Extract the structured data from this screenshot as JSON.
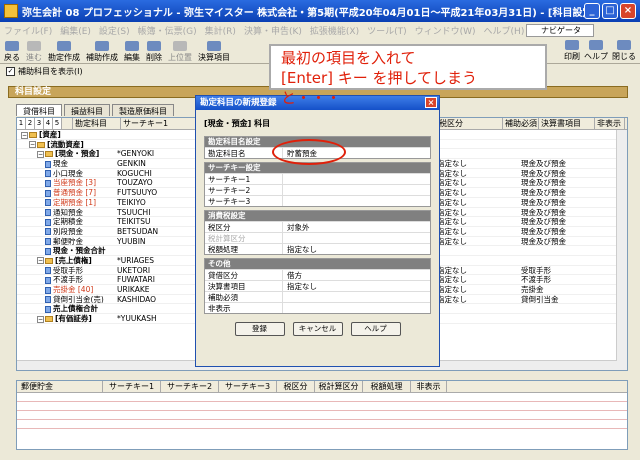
{
  "window": {
    "title": "弥生会計 08 プロフェッショナル - 弥生マイスター 株式会社・第5期(平成20年04月01日～平成21年03月31日) - [科目設定]"
  },
  "menu": [
    "ファイル(F)",
    "編集(E)",
    "設定(S)",
    "帳簿・伝票(G)",
    "集計(R)",
    "決算・申告(K)",
    "拡張機能(X)",
    "ツール(T)",
    "ウィンドウ(W)",
    "ヘルプ(H)"
  ],
  "navigator": "ナビゲータ",
  "toolbar": {
    "back": "戻る",
    "forward": "進む",
    "new_account": "勘定作成",
    "new_sub": "補助作成",
    "edit": "編集",
    "delete": "削除",
    "hide": "上位置",
    "settlement": "決算項目",
    "print": "印刷",
    "help": "ヘルプ",
    "close": "閉じる"
  },
  "subbar": {
    "show_sub": "補助科目を表示(I)"
  },
  "callout": {
    "line1": "最初の項目を入れて",
    "line2": "[Enter] キー を押してしまうと・・・"
  },
  "section": "科目設定",
  "tabs": [
    "貸借科目",
    "損益科目",
    "製造原価科目"
  ],
  "grid": {
    "headers": [
      "勘定科目",
      "サーチキー1",
      "税区分",
      "税区分",
      "補助必須",
      "決算書項目",
      "非表示"
    ],
    "numtabs": [
      "1",
      "2",
      "3",
      "4",
      "5"
    ],
    "rows": [
      {
        "name": "[資産]",
        "key": "",
        "r1": "",
        "r2": ""
      },
      {
        "name": "[流動資産]",
        "key": "",
        "r1": "",
        "r2": ""
      },
      {
        "name": "[現金・預金]",
        "key": "*GENYOKI",
        "r1": "",
        "r2": ""
      },
      {
        "name": "現金",
        "key": "GENKIN",
        "r1": "指定なし",
        "r2": "現金及び預金"
      },
      {
        "name": "小口現金",
        "key": "KOGUCHI",
        "r1": "指定なし",
        "r2": "現金及び預金"
      },
      {
        "name": "当座預金 [3]",
        "key": "TOUZAYO",
        "r1": "指定なし",
        "r2": "現金及び預金"
      },
      {
        "name": "普通預金 [7]",
        "key": "FUTSUUYO",
        "r1": "指定なし",
        "r2": "現金及び預金"
      },
      {
        "name": "定期預金 [1]",
        "key": "TEIKIYO",
        "r1": "指定なし",
        "r2": "現金及び預金"
      },
      {
        "name": "通知預金",
        "key": "TSUUCHI",
        "r1": "指定なし",
        "r2": "現金及び預金"
      },
      {
        "name": "定期積金",
        "key": "TEIKITSU",
        "r1": "指定なし",
        "r2": "現金及び預金"
      },
      {
        "name": "別段預金",
        "key": "BETSUDAN",
        "r1": "指定なし",
        "r2": "現金及び預金"
      },
      {
        "name": "郵便貯金",
        "key": "YUUBIN",
        "r1": "指定なし",
        "r2": "現金及び預金"
      },
      {
        "name": "現金・預金合計",
        "key": "",
        "r1": "",
        "r2": ""
      },
      {
        "name": "[売上債権]",
        "key": "*URIAGES",
        "r1": "",
        "r2": ""
      },
      {
        "name": "受取手形",
        "key": "UKETORI",
        "r1": "指定なし",
        "r2": "受取手形"
      },
      {
        "name": "不渡手形",
        "key": "FUWATARI",
        "r1": "指定なし",
        "r2": "不渡手形"
      },
      {
        "name": "売掛金 [40]",
        "key": "URIKAKE",
        "r1": "指定なし",
        "r2": "売掛金"
      },
      {
        "name": "貸倒引当金(売)",
        "key": "KASHIDAO",
        "r1": "指定なし",
        "r2": "貸倒引当金"
      },
      {
        "name": "売上債権合計",
        "key": "",
        "r1": "",
        "r2": ""
      },
      {
        "name": "[有価証券]",
        "key": "*YUUKASH",
        "r1": "",
        "r2": ""
      }
    ]
  },
  "bottom": {
    "label": "郵便貯金",
    "headers": [
      "サーチキー1",
      "サーチキー2",
      "サーチキー3",
      "税区分",
      "税計算区分",
      "税額処理",
      "非表示"
    ]
  },
  "dialog": {
    "title": "勘定科目の新規登録",
    "subtitle": "[現金・預金] 科目",
    "group1": {
      "head": "勘定科目名設定",
      "label": "勘定科目名",
      "value": "貯蓄預金"
    },
    "group2": {
      "head": "サーチキー設定",
      "rows": [
        "サーチキー1",
        "サーチキー2",
        "サーチキー3"
      ]
    },
    "group3": {
      "head": "消費税設定",
      "rows": [
        {
          "l": "税区分",
          "v": "対象外"
        },
        {
          "l": "税計算区分",
          "v": ""
        },
        {
          "l": "税額処理",
          "v": "指定なし"
        }
      ]
    },
    "group4": {
      "head": "その他",
      "rows": [
        {
          "l": "貸借区分",
          "v": "借方"
        },
        {
          "l": "決算書項目",
          "v": "指定なし"
        },
        {
          "l": "補助必須",
          "v": ""
        },
        {
          "l": "非表示",
          "v": ""
        }
      ]
    },
    "buttons": {
      "register": "登録",
      "cancel": "キャンセル",
      "help": "ヘルプ"
    }
  }
}
